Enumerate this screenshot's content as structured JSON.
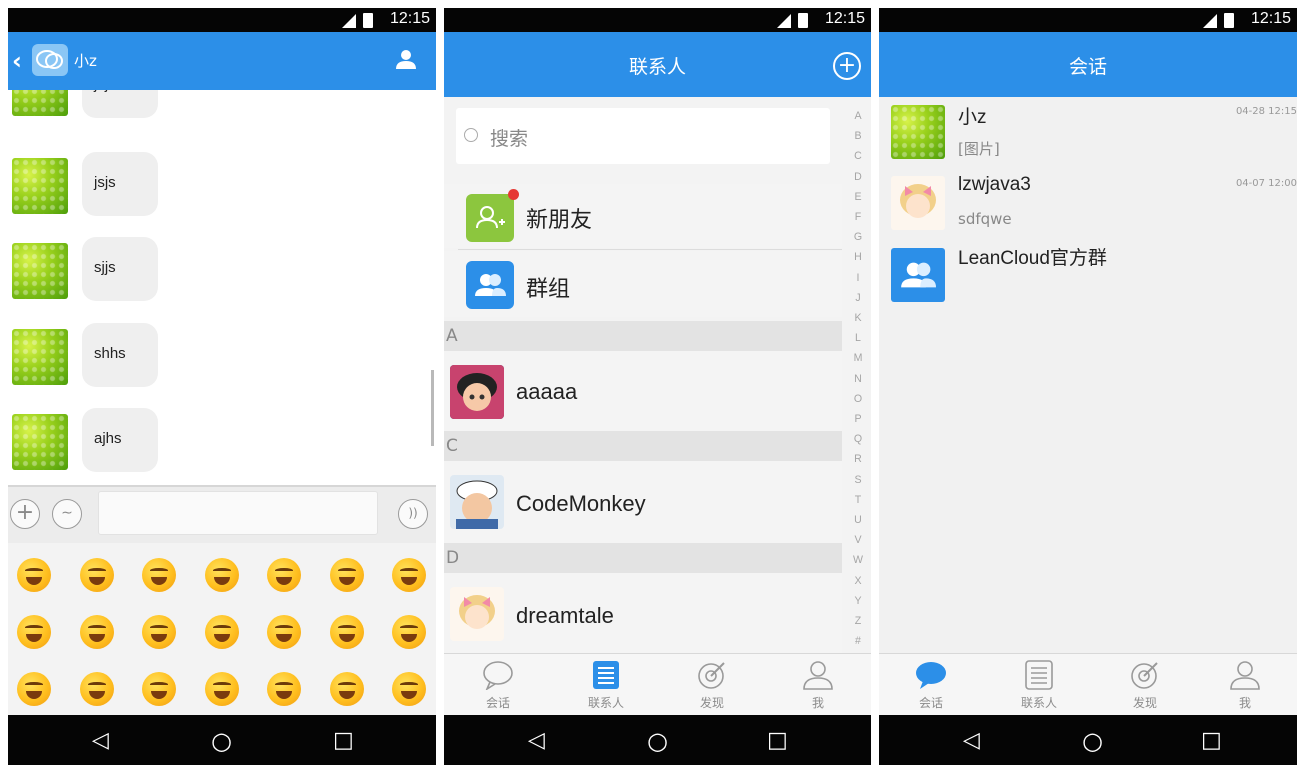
{
  "status": {
    "time": "12:15"
  },
  "chat": {
    "title": "小z",
    "messages": [
      {
        "text": "jsjs"
      },
      {
        "text": "jsjs"
      },
      {
        "text": "sjjs"
      },
      {
        "text": "shhs"
      },
      {
        "text": "ajhs"
      }
    ],
    "emoji_count": 21
  },
  "contacts": {
    "title": "联系人",
    "search_placeholder": "搜索",
    "new_friends": "新朋友",
    "groups": "群组",
    "index_letters": "A B C D E F G H I J K L M N O P Q R S T U V W X Y Z #",
    "sections": [
      {
        "letter": "A",
        "name": "aaaaa"
      },
      {
        "letter": "C",
        "name": "CodeMonkey"
      },
      {
        "letter": "D",
        "name": "dreamtale"
      }
    ]
  },
  "conversations": {
    "title": "会话",
    "items": [
      {
        "name": "小z",
        "sub": "[图片]",
        "time": "04-28 12:15"
      },
      {
        "name": "lzwjava3",
        "sub": "sdfqwe",
        "time": "04-07 12:00"
      },
      {
        "name": "LeanCloud官方群",
        "sub": "",
        "time": ""
      }
    ]
  },
  "tabs": [
    {
      "label": "会话",
      "icon": "chat-bubble-icon"
    },
    {
      "label": "联系人",
      "icon": "contacts-list-icon"
    },
    {
      "label": "发现",
      "icon": "discover-icon"
    },
    {
      "label": "我",
      "icon": "person-icon"
    }
  ],
  "colors": {
    "accent": "#2c8fe8",
    "new_badge": "#e53935",
    "new_friends_icon": "#8cc63e"
  }
}
